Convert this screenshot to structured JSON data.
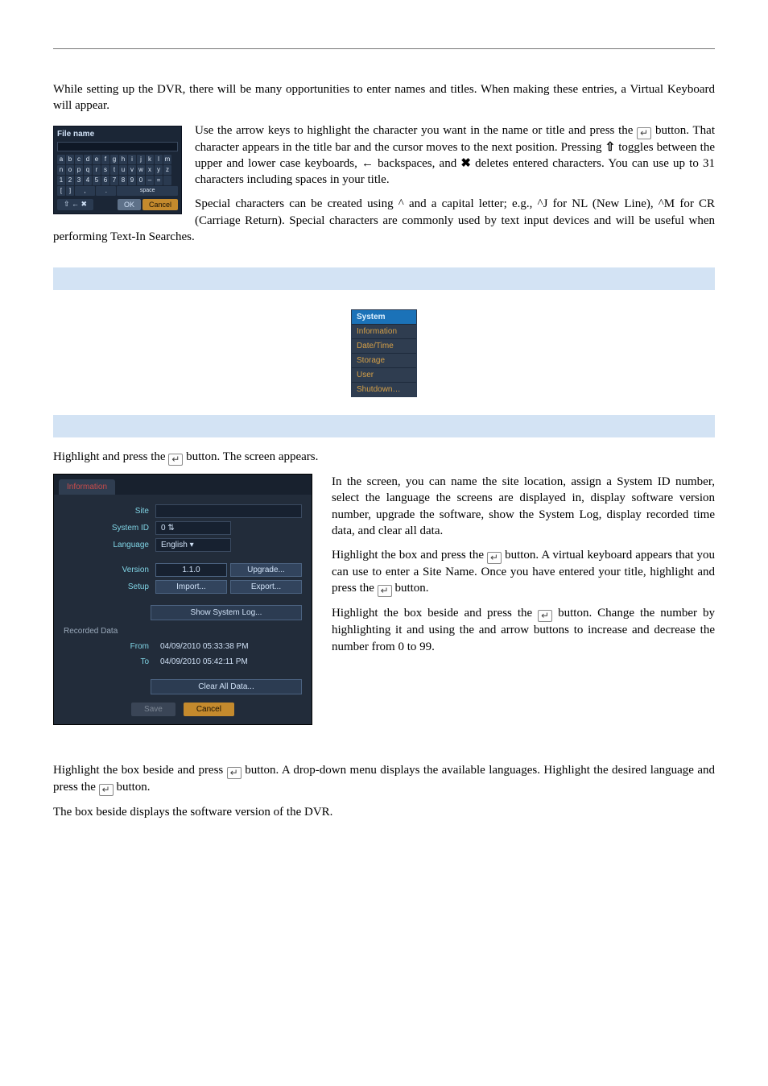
{
  "intro_para": "While setting up the DVR, there will be many opportunities to enter names and titles.  When making these entries, a Virtual Keyboard will appear.",
  "kbd_fig": {
    "title": "File name",
    "row1": [
      "a",
      "b",
      "c",
      "d",
      "e",
      "f",
      "g",
      "h",
      "i",
      "j",
      "k",
      "l",
      "m"
    ],
    "row2": [
      "n",
      "o",
      "p",
      "q",
      "r",
      "s",
      "t",
      "u",
      "v",
      "w",
      "x",
      "y",
      "z"
    ],
    "row3": [
      "1",
      "2",
      "3",
      "4",
      "5",
      "6",
      "7",
      "8",
      "9",
      "0",
      "–",
      "=",
      " "
    ],
    "row4": [
      "[",
      "]",
      " ",
      " ",
      " ",
      ",",
      ".",
      "",
      "",
      "",
      "",
      "",
      ""
    ],
    "bar_left": "⇧ ← ✖",
    "ok": "OK",
    "cancel": "Cancel",
    "space": "space"
  },
  "kbd_para1_a": "Use the arrow keys to highlight the character you want in the name or title and press the ",
  "kbd_para1_b": " button.  That character appears in the title bar and the cursor moves to the next position.  Pressing ",
  "kbd_para1_c": " toggles between the upper and lower case keyboards, ",
  "kbd_para1_d": " backspaces, and ",
  "kbd_para1_e": " deletes entered characters.  You can use up to 31 characters including spaces in your title.",
  "kbd_para2": "Special characters can be created using ^ and a capital letter; e.g., ^J for NL (New Line), ^M for CR (Carriage Return).  Special characters are commonly used by text input devices and will be useful when performing Text-In Searches.",
  "sysmenu": {
    "head": "System",
    "items": [
      "Information",
      "Date/Time",
      "Storage",
      "User",
      "Shutdown…"
    ]
  },
  "para_open_a": "Highlight ",
  "para_open_b": " and press the ",
  "para_open_c": " button.  The ",
  "para_open_d": " screen appears.",
  "info_fig": {
    "tab": "Information",
    "labels": {
      "site": "Site",
      "systemid": "System ID",
      "language": "Language",
      "version": "Version",
      "setup": "Setup",
      "from": "From",
      "to": "To"
    },
    "values": {
      "systemid": "0",
      "language": "English",
      "version": "1.1.0",
      "from": "04/09/2010  05:33:38 PM",
      "to": "04/09/2010  05:42:11 PM"
    },
    "buttons": {
      "upgrade": "Upgrade...",
      "import": "Import...",
      "export": "Export...",
      "showlog": "Show System Log...",
      "clearall": "Clear All Data...",
      "save": "Save",
      "cancel": "Cancel"
    },
    "section": "Recorded Data"
  },
  "right_p1_a": "In the ",
  "right_p1_b": " screen, you can name the site location, assign a System ID number, select the language the screens are displayed in, display software version number, upgrade the software, show the System Log, display recorded time data, and clear all data.",
  "right_p2_a": "Highlight the ",
  "right_p2_b": " box and press the ",
  "right_p2_c": " button.  A virtual keyboard appears that you can use to enter a Site Name.  Once you have entered your title, highlight ",
  "right_p2_d": " and press the ",
  "right_p2_e": " button.",
  "right_p3_a": "Highlight the box beside ",
  "right_p3_b": " and press the ",
  "right_p3_c": " button.  Change the number by highlighting it and using the ",
  "right_p3_d": " and ",
  "right_p3_e": " arrow buttons to increase and decrease the number from 0 to 99.",
  "bottom_p1_a": "Highlight the box beside ",
  "bottom_p1_b": " and press ",
  "bottom_p1_c": " button.  A drop-down menu displays the available languages.  Highlight the desired language and press the ",
  "bottom_p1_d": " button.",
  "bottom_p2_a": "The box beside ",
  "bottom_p2_b": " displays the software version of the DVR.",
  "icons": {
    "enter": "↵",
    "updown": "⇧",
    "back": "←",
    "erase": "✖"
  }
}
